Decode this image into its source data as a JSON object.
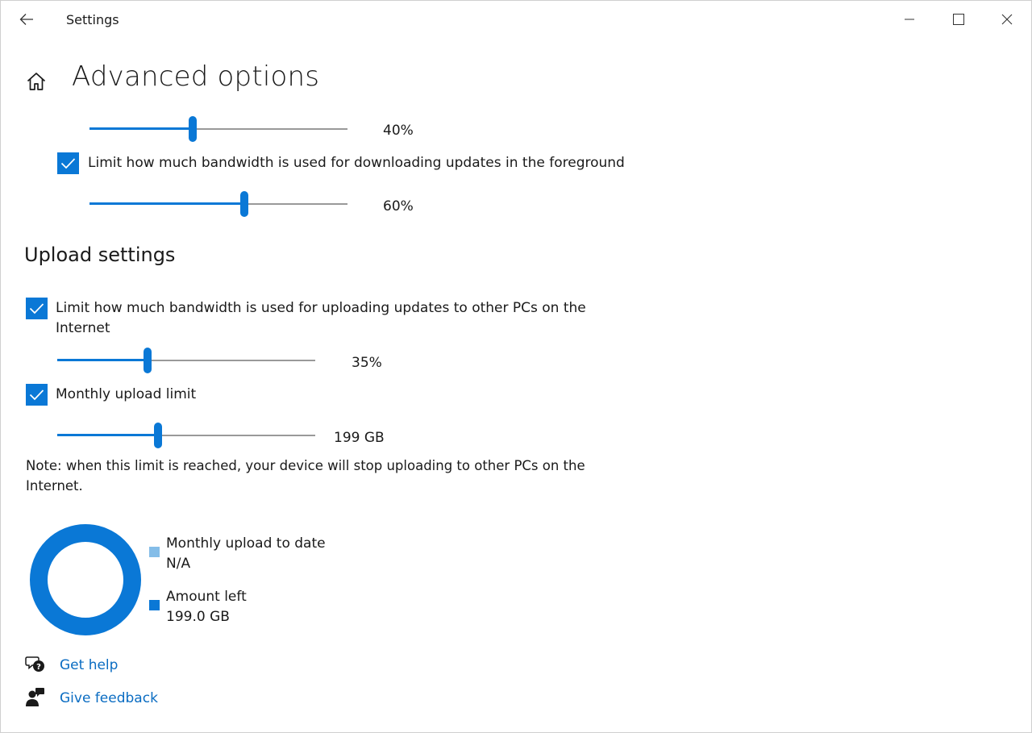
{
  "titlebar": {
    "app_title": "Settings"
  },
  "header": {
    "title": "Advanced options"
  },
  "download": {
    "background_slider": {
      "value": "40%",
      "percent": 40
    },
    "foreground_checkbox": {
      "label": "Limit how much bandwidth is used for downloading updates in the foreground",
      "checked": true
    },
    "foreground_slider": {
      "value": "60%",
      "percent": 60
    }
  },
  "upload": {
    "section_title": "Upload settings",
    "bandwidth_checkbox": {
      "label": "Limit how much bandwidth is used for uploading updates to other PCs on the Internet",
      "checked": true
    },
    "bandwidth_slider": {
      "value": "35%",
      "percent": 35
    },
    "monthly_checkbox": {
      "label": "Monthly upload limit",
      "checked": true
    },
    "monthly_slider": {
      "value": "199 GB",
      "percent": 39
    },
    "note": "Note: when this limit is reached, your device will stop uploading to other PCs on the Internet."
  },
  "usage": {
    "uploaded_label": "Monthly upload to date",
    "uploaded_value": "N/A",
    "left_label": "Amount left",
    "left_value": "199.0 GB",
    "colors": {
      "uploaded": "#84bde8",
      "left": "#0a78d6"
    }
  },
  "links": {
    "help": "Get help",
    "feedback": "Give feedback"
  },
  "colors": {
    "accent": "#0a78d6",
    "link": "#0a6cc2"
  },
  "icons": {
    "back": "back-arrow-icon",
    "home": "home-icon",
    "minimize": "minimize-icon",
    "maximize": "maximize-icon",
    "close": "close-icon",
    "help": "help-chat-icon",
    "feedback": "feedback-person-icon"
  }
}
